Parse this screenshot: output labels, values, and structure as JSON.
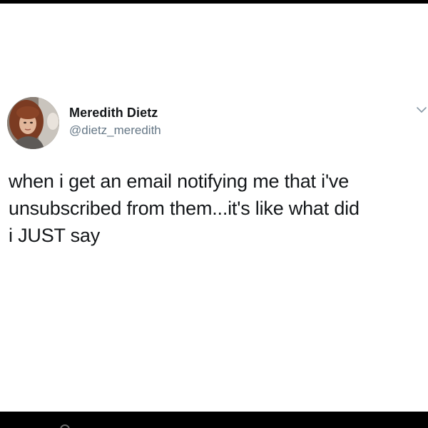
{
  "tweet": {
    "author": {
      "display_name": "Meredith Dietz",
      "handle": "@dietz_meredith",
      "avatar_icon": "profile-photo"
    },
    "menu_icon": "chevron-down-icon",
    "text": "when i get an email notifying me that i've\nunsubscribed from them...it's like what did\ni JUST say"
  },
  "colors": {
    "text_primary": "#14171a",
    "text_secondary": "#657786",
    "frame_bars": "#000000",
    "background": "#ffffff"
  }
}
